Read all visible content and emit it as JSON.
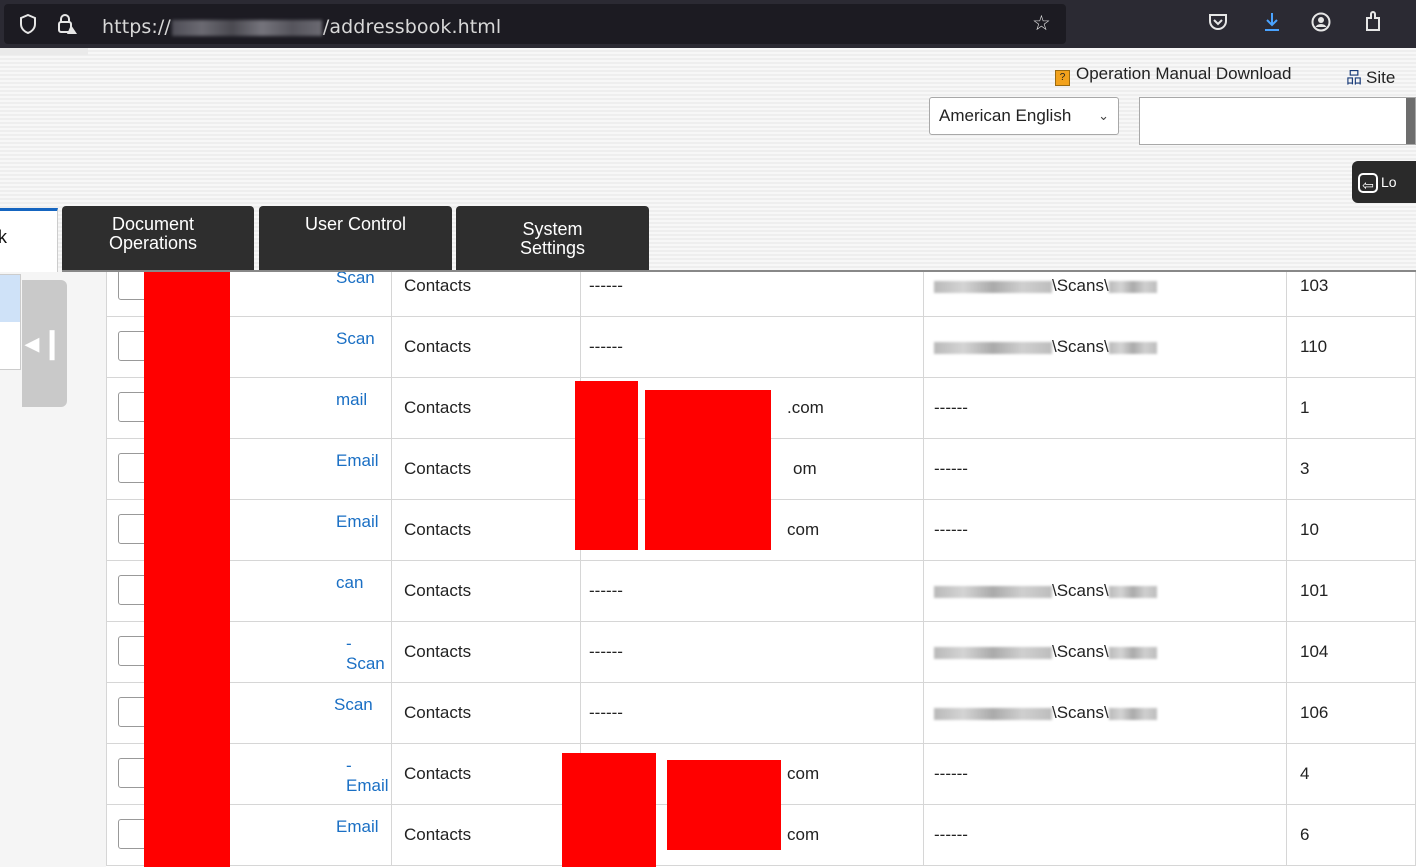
{
  "browser": {
    "url_prefix": "https://",
    "url_suffix": "/addressbook.html",
    "icons": [
      "shield-icon",
      "lock-warning-icon",
      "star-icon",
      "pocket-icon",
      "download-icon",
      "account-icon",
      "extensions-icon"
    ]
  },
  "header": {
    "manual_link": "Operation Manual Download",
    "sitemap_link": "Site",
    "language_selected": "American English",
    "logout_label": "Lo"
  },
  "tabs": {
    "address_book": "ok",
    "document_operations": "Document Operations",
    "user_control": "User Control",
    "system_settings": "System Settings"
  },
  "table": {
    "rows": [
      {
        "name": "Scan",
        "type": "Contacts",
        "email": "------",
        "path": "\\Scans\\",
        "number": "103"
      },
      {
        "name": "Scan",
        "type": "Contacts",
        "email": "------",
        "path": "\\Scans\\",
        "number": "110"
      },
      {
        "name": "mail",
        "type": "Contacts",
        "email": ".com",
        "path": "------",
        "number": "1"
      },
      {
        "name": "Email",
        "type": "Contacts",
        "email": "om",
        "path": "------",
        "number": "3"
      },
      {
        "name": "Email",
        "type": "Contacts",
        "email": "com",
        "path": "------",
        "number": "10"
      },
      {
        "name": "can",
        "type": "Contacts",
        "email": "------",
        "path": "\\Scans\\",
        "number": "101"
      },
      {
        "name": "- Scan",
        "type": "Contacts",
        "email": "------",
        "path": "\\Scans\\",
        "number": "104"
      },
      {
        "name": "Scan",
        "type": "Contacts",
        "email": "------",
        "path": "\\Scans\\",
        "number": "106"
      },
      {
        "name": "- Email",
        "type": "Contacts",
        "email": "com",
        "path": "------",
        "number": "4"
      },
      {
        "name": "Email",
        "type": "Contacts",
        "email": "com",
        "path": "------",
        "number": "6"
      }
    ]
  },
  "colors": {
    "tab_dark": "#2e2e2e",
    "link_blue": "#1a6fc4",
    "redaction": "#ff0000"
  }
}
